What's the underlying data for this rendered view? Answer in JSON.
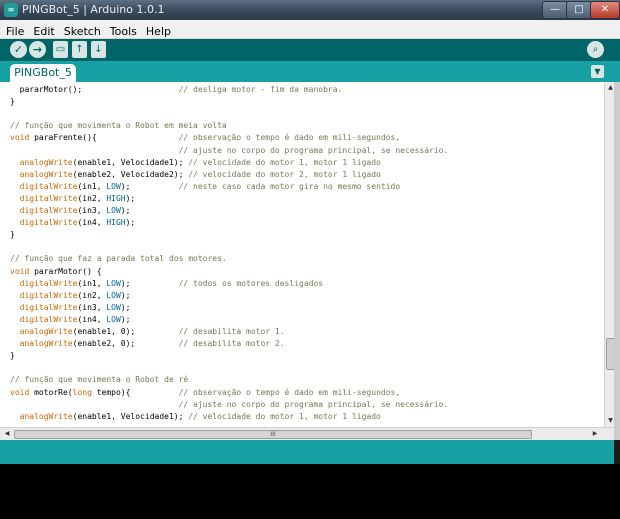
{
  "window": {
    "app_icon": "infinity-icon",
    "title": "PINGBot_5 | Arduino 1.0.1",
    "controls": {
      "minimize": "—",
      "maximize": "□",
      "close": "✕"
    }
  },
  "menubar": [
    "File",
    "Edit",
    "Sketch",
    "Tools",
    "Help"
  ],
  "toolbar": {
    "verify_icon": "✓",
    "upload_icon": "→",
    "new_icon": "▭",
    "open_icon": "↑",
    "save_icon": "↓",
    "serial_monitor_icon": "⌕"
  },
  "tabs": [
    {
      "label": "PINGBot_5",
      "active": true
    }
  ],
  "tab_menu_icon": "▼",
  "code_lines": [
    "  pararMotor();                    // desliga motor - fim da manobra.",
    "}",
    "",
    "// função que movimenta o Robot em meia volta",
    "void paraFrente(){                 // observação o tempo é dado em mili-segundos,",
    "                                   // ajuste no corpo do programa principal, se necessário.",
    "  analogWrite(enable1, Velocidade1); // velocidade do motor 1, motor 1 ligado",
    "  analogWrite(enable2, Velocidade2); // velocidade do motor 2, motor 1 ligado",
    "  digitalWrite(in1, LOW);          // neste caso cada motor gira no mesmo sentido",
    "  digitalWrite(in2, HIGH);",
    "  digitalWrite(in3, LOW);",
    "  digitalWrite(in4, HIGH);",
    "}",
    "",
    "// função que faz a parada total dos motores.",
    "void pararMotor() {",
    "  digitalWrite(in1, LOW);          // todos os motores desligados",
    "  digitalWrite(in2, LOW);",
    "  digitalWrite(in3, LOW);",
    "  digitalWrite(in4, LOW);",
    "  analogWrite(enable1, 0);         // desabilita motor 1.",
    "  analogWrite(enable2, 0);         // desabilita motor 2.",
    "}",
    "",
    "// função que movimenta o Robot de ré",
    "void motorRe(long tempo){          // observação o tempo é dado em mili-segundos,",
    "                                   // ajuste no corpo do programa principal, se necessário.",
    "  analogWrite(enable1, Velocidade1); // velocidade do motor 1, motor 1 ligado"
  ],
  "syntax_colors": {
    "keyword": "#cc6600",
    "constant": "#006699",
    "comment": "#777755"
  },
  "scroll": {
    "up": "▲",
    "down": "▼",
    "left": "◀",
    "right": "▶",
    "thumb_grip": "III"
  },
  "colors": {
    "toolbar": "#006468",
    "tabbar": "#17a1a5",
    "console": "#000000"
  }
}
